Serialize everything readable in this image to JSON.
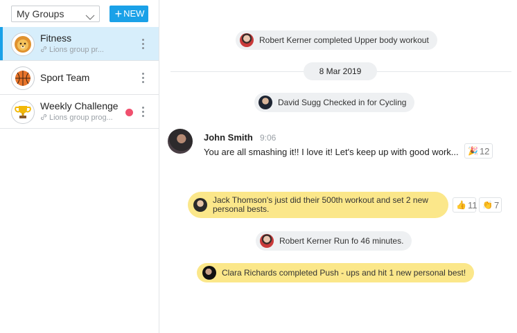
{
  "sidebar": {
    "select_value": "My Groups",
    "new_button": "NEW",
    "groups": [
      {
        "name": "Fitness",
        "subtitle": "Lions group pr...",
        "icon": "lion-icon",
        "active": true
      },
      {
        "name": "Sport Team",
        "subtitle": "",
        "icon": "basketball-icon",
        "active": false
      },
      {
        "name": "Weekly Challenge",
        "subtitle": "Lions group prog...",
        "icon": "trophy-icon",
        "active": false,
        "unread": true
      }
    ]
  },
  "chat": {
    "events": [
      {
        "text": "Robert Kerner completed Upper body workout",
        "avatar": "robert-kerner-avatar"
      },
      {
        "text": "David Sugg Checked in for Cycling",
        "avatar": "david-sugg-avatar"
      },
      {
        "text": "Jack Thomson's just did their 500th workout and set 2 new personal bests.",
        "avatar": "jack-thomson-avatar",
        "highlighted": true
      },
      {
        "text": "Robert Kerner Run fo 46 minutes.",
        "avatar": "robert-kerner-avatar"
      },
      {
        "text": "Clara Richards completed Push - ups and hit 1 new personal best!",
        "avatar": "clara-richards-avatar",
        "highlighted": true
      }
    ],
    "date_separator": "8 Mar 2019",
    "message": {
      "author": "John Smith",
      "time": "9:06",
      "text": "You are all smashing it!! I love it! Let's keep up with good work...",
      "reactions": [
        {
          "icon": "party-popper-icon",
          "count": "12"
        }
      ]
    },
    "jack_reactions": [
      {
        "icon": "thumbs-up-icon",
        "count": "11"
      },
      {
        "icon": "clapping-hands-icon",
        "count": "7"
      }
    ]
  },
  "colors": {
    "accent": "#1aa1e8",
    "highlight": "#fbe78a",
    "unread": "#f0506e",
    "active_row": "#d7eefb"
  }
}
